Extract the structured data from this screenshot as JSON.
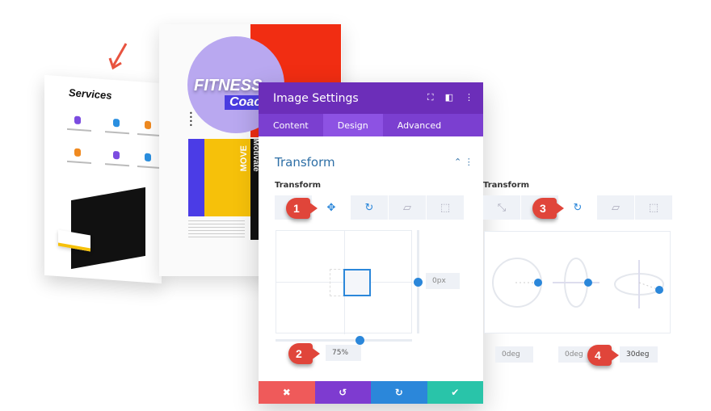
{
  "background_pages": {
    "services_title": "Services",
    "hero_word_1": "FITNESS",
    "hero_word_2": "Coach",
    "side_word": "Motivate",
    "overlay_word": "MOVE"
  },
  "panel": {
    "title": "Image Settings",
    "header_icons": [
      "fullscreen-icon",
      "split-view-icon",
      "more-icon"
    ],
    "tabs": [
      {
        "label": "Content"
      },
      {
        "label": "Design",
        "active": true
      },
      {
        "label": "Advanced"
      }
    ],
    "section_title": "Transform",
    "field_label": "Transform",
    "transform_tools": [
      "translate",
      "rotate",
      "skew",
      "origin"
    ],
    "active_tool": "translate",
    "translate_y_value": "0px",
    "translate_x_value": "75%",
    "footer": {
      "cancel": "✖",
      "undo": "↺",
      "redo": "↻",
      "save": "✔"
    }
  },
  "rotate_panel": {
    "field_label": "Transform",
    "transform_tools": [
      "scale",
      "translate",
      "rotate",
      "skew",
      "origin"
    ],
    "active_tool": "rotate",
    "rotate_x": "0deg",
    "rotate_y": "0deg",
    "rotate_z": "30deg"
  },
  "callouts": [
    "1",
    "2",
    "3",
    "4"
  ],
  "colors": {
    "header": "#6c2eb9",
    "tabs": "#7b3fd0",
    "accent": "#2b87da",
    "cancel": "#ef5a5a",
    "undo": "#7e3bd0",
    "redo": "#2b87da",
    "save": "#29c4a9",
    "callout": "#e0453a"
  }
}
